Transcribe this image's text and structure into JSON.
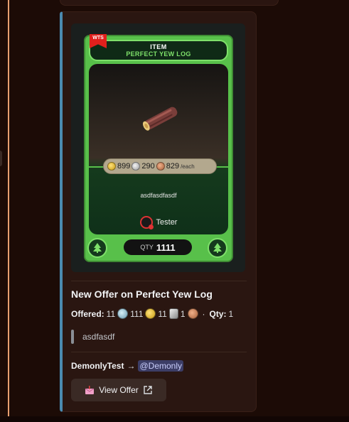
{
  "card": {
    "badge": "WTS",
    "header_label": "ITEM",
    "item_name": "PERFECT YEW LOG",
    "price": {
      "gold": "899",
      "silver": "290",
      "bronze": "829",
      "unit": "/each"
    },
    "note": "asdfasdfasdf",
    "seller": "Tester",
    "qty_label": "QTY",
    "qty_value": "1111"
  },
  "embed": {
    "title": "New Offer on Perfect Yew Log",
    "offered_label": "Offered:",
    "offered": {
      "platinum": "11",
      "gold": "111",
      "silver": "11",
      "bronze": "1"
    },
    "separator": "·",
    "qty_label": "Qty:",
    "qty_value": "1",
    "quote": "asdfasdf",
    "from_user": "DemonlyTest",
    "arrow": "→",
    "to_mention": "@Demonly",
    "button_label": "View Offer"
  },
  "colors": {
    "accent_border": "#4a8ab0",
    "card_green": "#58c04a",
    "wts_red": "#e0201c"
  }
}
